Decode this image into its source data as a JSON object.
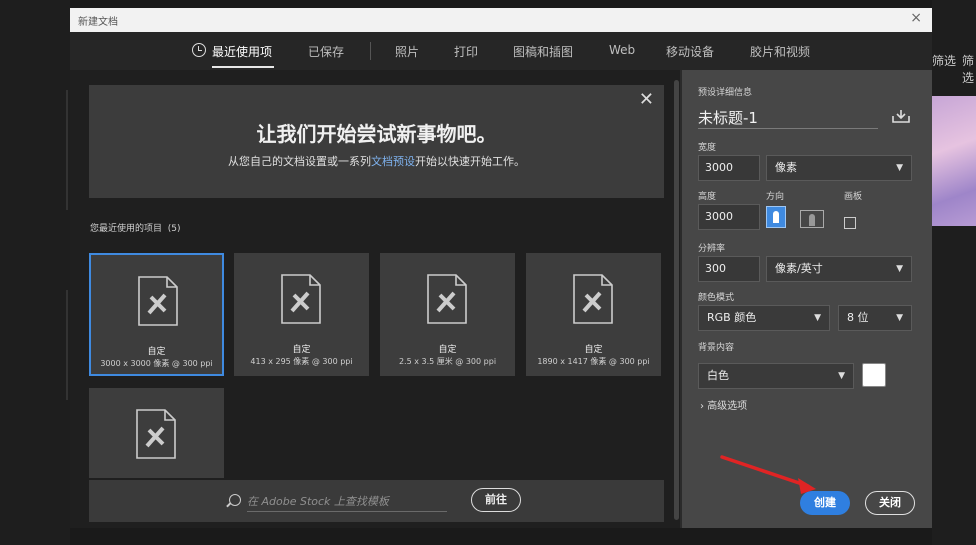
{
  "window": {
    "title": "新建文档",
    "close_glyph": "×"
  },
  "tabs": [
    {
      "label": "最近使用项",
      "active": true
    },
    {
      "label": "已保存"
    },
    {
      "label": "照片"
    },
    {
      "label": "打印"
    },
    {
      "label": "图稿和插图"
    },
    {
      "label": "Web"
    },
    {
      "label": "移动设备"
    },
    {
      "label": "胶片和视频"
    }
  ],
  "hero": {
    "heading": "让我们开始尝试新事物吧。",
    "sub_before": "从您自己的文档设置或一系列",
    "sub_link": "文档预设",
    "sub_after": "开始以快速开始工作。",
    "close_glyph": "✕"
  },
  "recent": {
    "label": "您最近使用的项目",
    "count": "(5)",
    "items": [
      {
        "name": "自定",
        "size": "3000 x 3000 像素 @ 300 ppi",
        "selected": true
      },
      {
        "name": "自定",
        "size": "413 x 295 像素 @ 300 ppi"
      },
      {
        "name": "自定",
        "size": "2.5 x 3.5 厘米 @ 300 ppi"
      },
      {
        "name": "自定",
        "size": "1890 x 1417 像素 @ 300 ppi"
      },
      {
        "name": "",
        "size": ""
      }
    ]
  },
  "stock": {
    "placeholder": "在 Adobe Stock 上查找模板",
    "go_label": "前往"
  },
  "preset": {
    "section_label": "预设详细信息",
    "doc_name": "未标题-1",
    "width_label": "宽度",
    "width_value": "3000",
    "width_unit": "像素",
    "height_label": "高度",
    "height_value": "3000",
    "orientation_label": "方向",
    "artboard_label": "画板",
    "resolution_label": "分辨率",
    "resolution_value": "300",
    "resolution_unit": "像素/英寸",
    "color_mode_label": "颜色模式",
    "color_mode_value": "RGB 颜色",
    "bit_depth_value": "8 位",
    "background_label": "背景内容",
    "background_value": "白色",
    "advanced_label": "高级选项",
    "create_label": "创建",
    "close_label": "关闭"
  },
  "background_app": {
    "right_labels": [
      "筛选",
      "筛选"
    ]
  },
  "colors": {
    "accent": "#2f7fe0",
    "arrow": "#e02424"
  }
}
